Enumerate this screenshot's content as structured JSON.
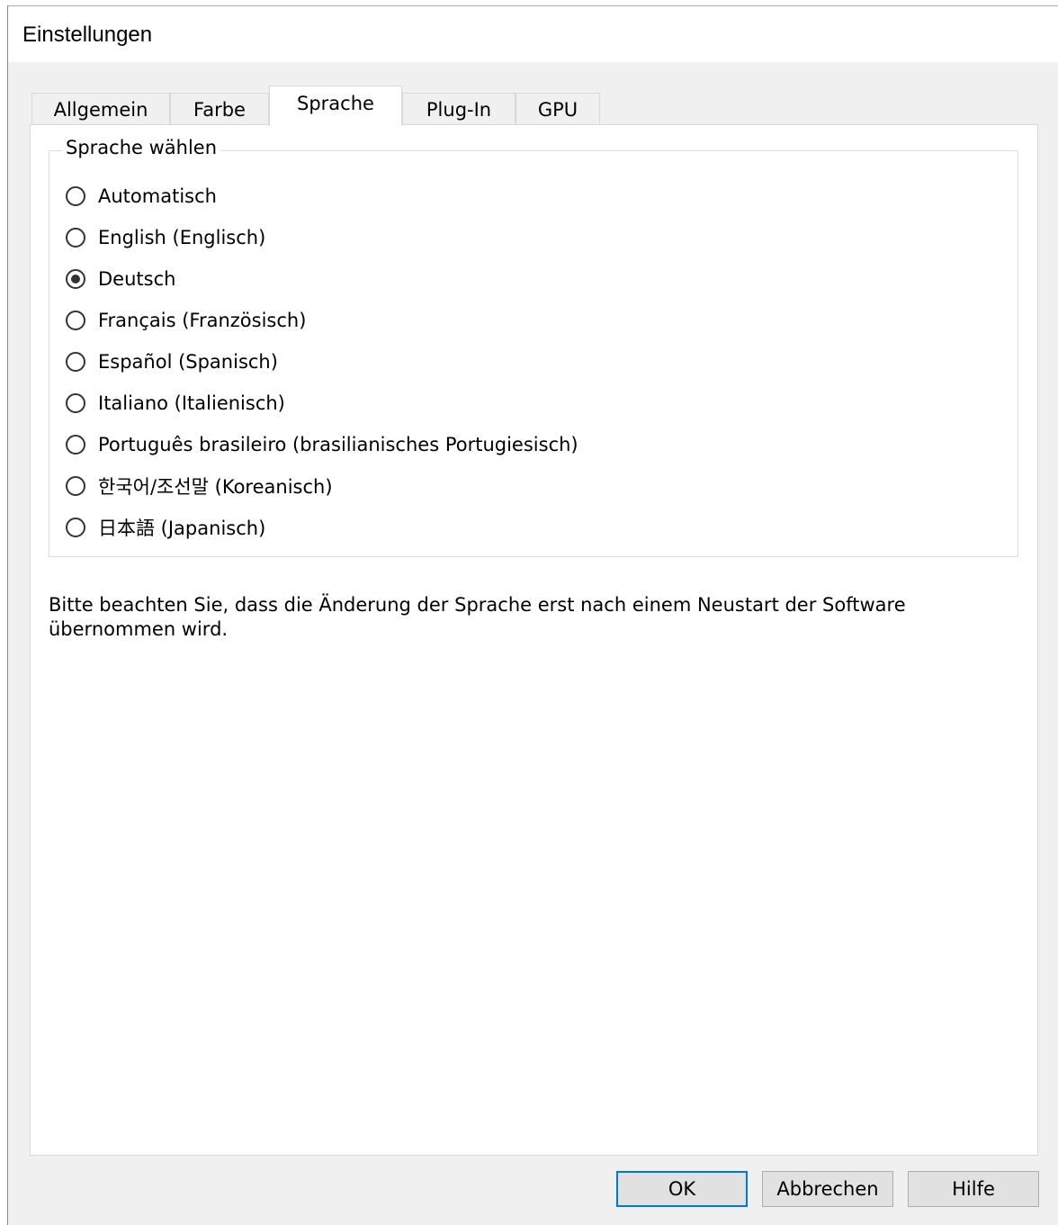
{
  "window": {
    "title": "Einstellungen"
  },
  "tabs": [
    {
      "label": "Allgemein",
      "active": false
    },
    {
      "label": "Farbe",
      "active": false
    },
    {
      "label": "Sprache",
      "active": true
    },
    {
      "label": "Plug-In",
      "active": false
    },
    {
      "label": "GPU",
      "active": false
    }
  ],
  "language_group": {
    "legend": "Sprache wählen",
    "options": [
      {
        "label": "Automatisch",
        "checked": false
      },
      {
        "label": "English (Englisch)",
        "checked": false
      },
      {
        "label": "Deutsch",
        "checked": true
      },
      {
        "label": "Français (Französisch)",
        "checked": false
      },
      {
        "label": "Español (Spanisch)",
        "checked": false
      },
      {
        "label": "Italiano (Italienisch)",
        "checked": false
      },
      {
        "label": "Português brasileiro (brasilianisches Portugiesisch)",
        "checked": false
      },
      {
        "label": "한국어/조선말 (Koreanisch)",
        "checked": false
      },
      {
        "label": "日本語 (Japanisch)",
        "checked": false
      }
    ]
  },
  "note": "Bitte beachten Sie, dass die Änderung der Sprache erst nach einem Neustart der Software übernommen wird.",
  "buttons": {
    "ok": "OK",
    "cancel": "Abbrechen",
    "help": "Hilfe"
  },
  "colors": {
    "accent": "#0078d7",
    "dialog_bg": "#f0f0f0",
    "panel_bg": "#ffffff"
  }
}
